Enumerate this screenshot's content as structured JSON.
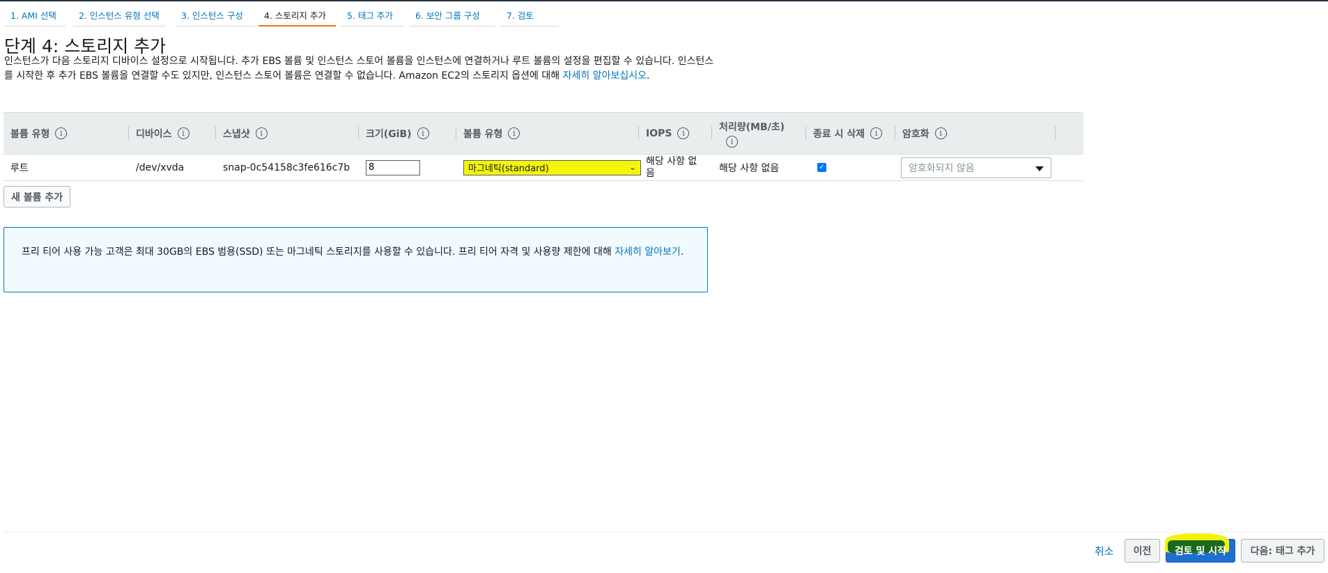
{
  "wizard": {
    "tabs": [
      {
        "label": "1. AMI 선택"
      },
      {
        "label": "2. 인스턴스 유형 선택"
      },
      {
        "label": "3. 인스턴스 구성"
      },
      {
        "label": "4. 스토리지 추가"
      },
      {
        "label": "5. 태그 추가"
      },
      {
        "label": "6. 보안 그룹 구성"
      },
      {
        "label": "7. 검토"
      }
    ],
    "active_index": 3
  },
  "page": {
    "title": "단계 4: 스토리지 추가",
    "description": "인스턴스가 다음 스토리지 디바이스 설정으로 시작됩니다. 추가 EBS 볼륨 및 인스턴스 스토어 볼륨을 인스턴스에 연결하거나 루트 볼륨의 설정을 편집할 수 있습니다. 인스턴스를 시작한 후 추가 EBS 볼륨을 연결할 수도 있지만, 인스턴스 스토어 볼륨은 연결할 수 없습니다. Amazon EC2의 스토리지 옵션에 대해 ",
    "description_link": "자세히 알아보십시오",
    "description_end": "."
  },
  "table": {
    "headers": {
      "volume_type": "볼륨 유형",
      "device": "디바이스",
      "snapshot": "스냅샷",
      "size": "크기(GiB)",
      "ebs_volume_type": "볼륨 유형",
      "iops": "IOPS",
      "throughput": "처리량(MB/초)",
      "delete_on_termination": "종료 시 삭제",
      "encryption": "암호화"
    },
    "info_glyph": "i",
    "rows": [
      {
        "volume_type": "루트",
        "device": "/dev/xvda",
        "snapshot": "snap-0c54158c3fe616c7b",
        "size": "8",
        "ebs_volume_type": "마그네틱(standard)",
        "iops": "해당 사항 없음",
        "throughput": "해당 사항 없음",
        "delete_on_termination": true,
        "encryption_placeholder": "암호화되지 않음"
      }
    ]
  },
  "add_volume_button": "새 볼륨 추가",
  "free_tier": {
    "text": "프리 티어 사용 가능 고객은 최대 30GB의 EBS 범용(SSD) 또는 마그네틱 스토리지를 사용할 수 있습니다. 프리 티어 자격 및 사용량 제한에 대해 ",
    "link": "자세히 알아보기",
    "end": "."
  },
  "footer": {
    "cancel": "취소",
    "previous": "이전",
    "review_and_launch": "검토 및 시작",
    "next": "다음: 태그 추가"
  },
  "colors": {
    "accent_tab": "#ec7211",
    "link": "#0073bb",
    "primary_button": "#1f6fd1",
    "highlight": "#f5f50a",
    "checkbox": "#0075ff"
  }
}
